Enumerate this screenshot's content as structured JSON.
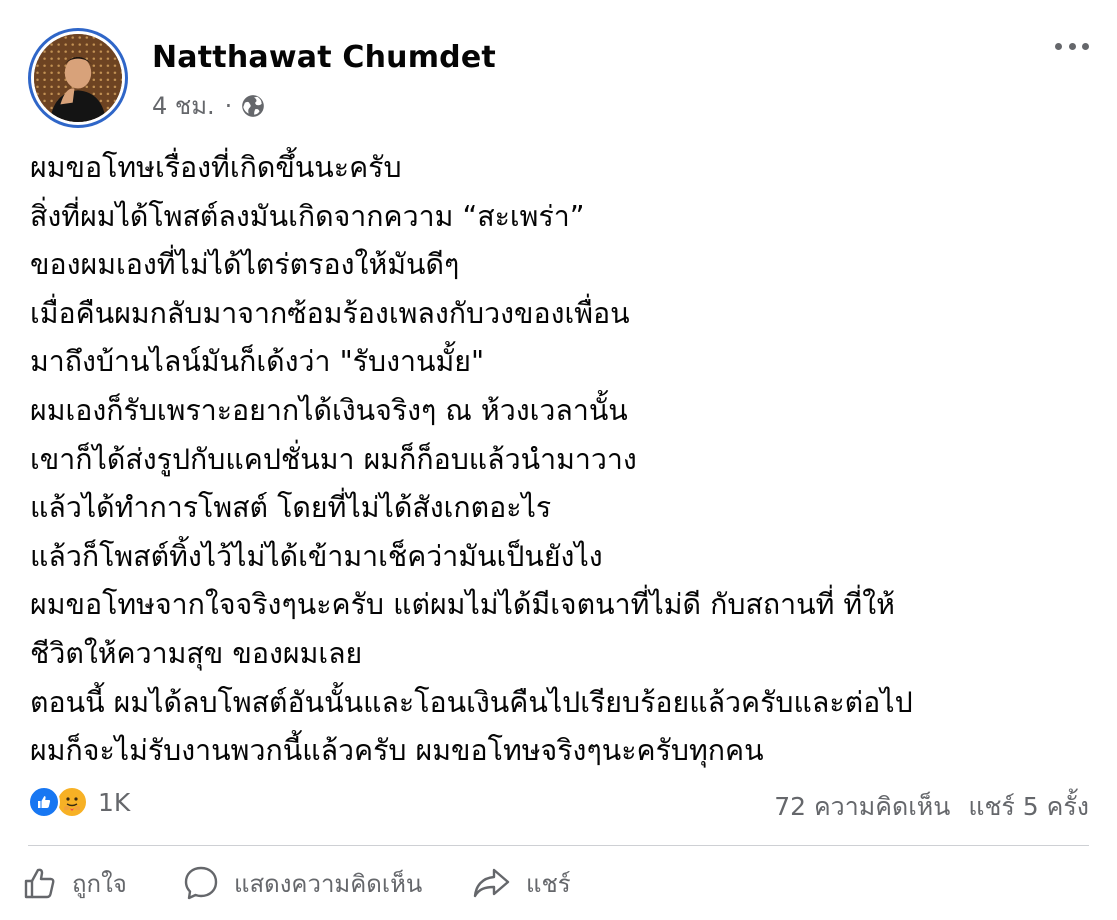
{
  "post": {
    "author": "Natthawat Chumdet",
    "time": "4 ชม.",
    "dot": "·",
    "privacy_icon": "globe-icon",
    "text_lines": [
      "ผมขอโทษเรื่องที่เกิดขึ้นนะครับ",
      "สิ่งที่ผมได้โพสต์ลงมันเกิดจากความ “สะเพร่า”",
      "ของผมเองที่ไม่ได้ไตร่ตรองให้มันดีๆ",
      "เมื่อคืนผมกลับมาจากซ้อมร้องเพลงกับวงของเพื่อน",
      "มาถึงบ้านไลน์มันก็เด้งว่า \"รับงานมั้ย\"",
      "ผมเองก็รับเพราะอยากได้เงินจริงๆ ณ ห้วงเวลานั้น",
      "เขาก็ได้ส่งรูปกับแคปชั่นมา ผมก็ก็อบแล้วนำมาวาง",
      "แล้วได้ทำการโพสต์ โดยที่ไม่ได้สังเกตอะไร",
      "แล้วก็โพสต์ทิ้งไว้ไม่ได้เข้ามาเช็คว่ามันเป็นยังไง",
      "ผมขอโทษจากใจจริงๆนะครับ แต่ผมไม่ได้มีเจตนาที่ไม่ดี กับสถานที่ ที่ให้",
      "ชีวิตให้ความสุข ของผมเลย",
      "ตอนนี้ ผมได้ลบโพสต์อันนั้นและโอนเงินคืนไปเรียบร้อยแล้วครับและต่อไป",
      "ผมก็จะไม่รับงานพวกนี้แล้วครับ ผมขอโทษจริงๆนะครับทุกคน"
    ]
  },
  "stats": {
    "reaction_icons": [
      "like-icon",
      "care-icon"
    ],
    "reaction_count": "1K",
    "comments": "72 ความคิดเห็น",
    "shares": "แชร์ 5 ครั้ง"
  },
  "actions": {
    "like": "ถูกใจ",
    "comment": "แสดงความคิดเห็น",
    "share": "แชร์"
  },
  "colors": {
    "text": "#050505",
    "secondary": "#65676b",
    "like_blue": "#1877f2",
    "avatar_ring": "#2f66c8"
  }
}
